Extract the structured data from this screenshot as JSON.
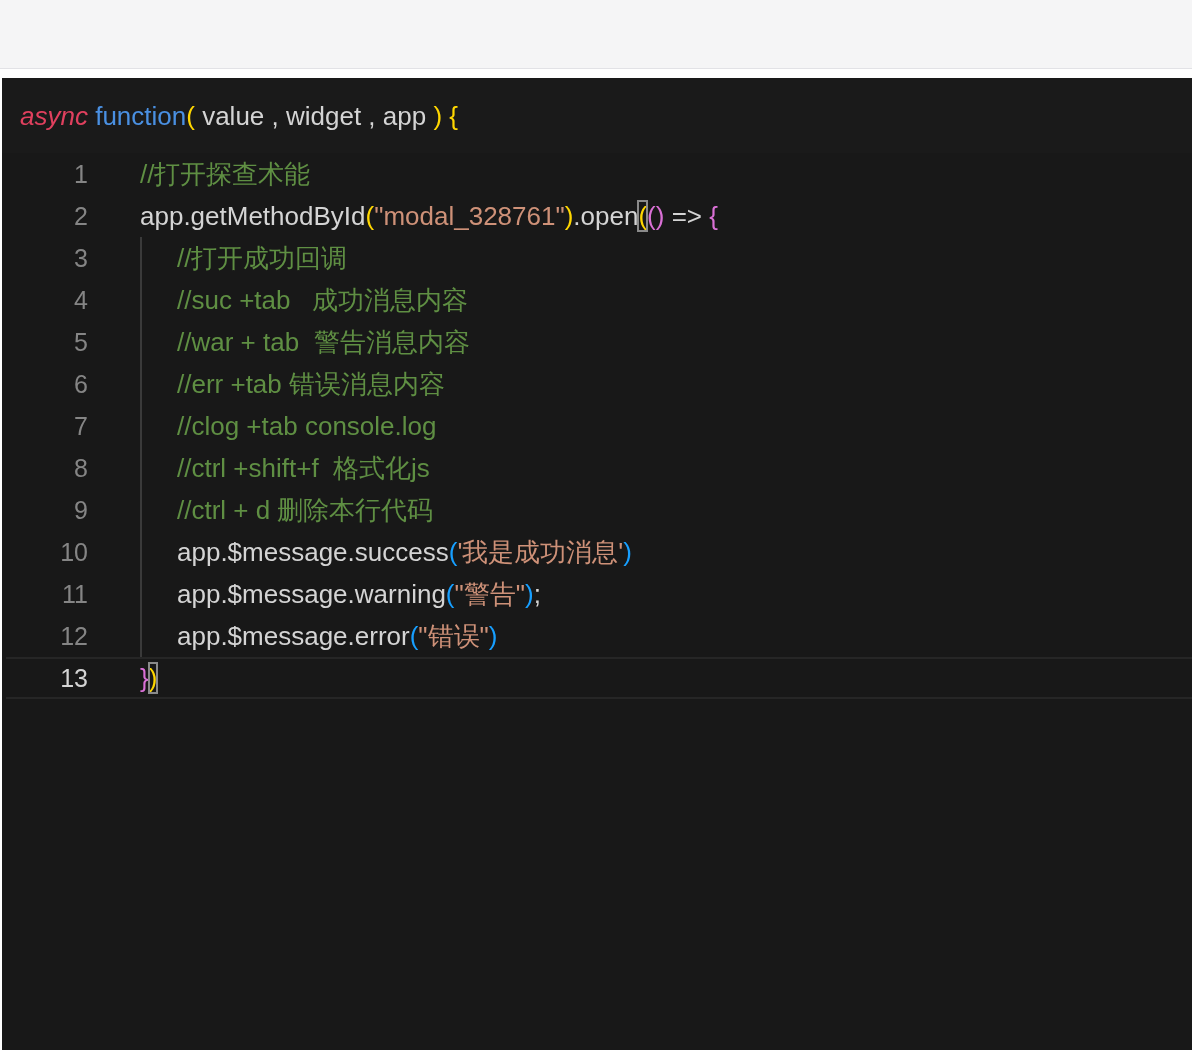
{
  "editor": {
    "signature": [
      {
        "kind": "keyword",
        "text": "async"
      },
      {
        "kind": "function",
        "text": "function"
      },
      {
        "kind": "paren1",
        "text": "("
      },
      {
        "kind": "plain",
        "text": " value , widget , app "
      },
      {
        "kind": "paren1",
        "text": ") {"
      }
    ],
    "lines": [
      {
        "number": "1",
        "current": false,
        "tokens": [
          {
            "kind": "comment",
            "text": "//打开探查术能"
          }
        ]
      },
      {
        "number": "2",
        "current": false,
        "tokens": [
          {
            "kind": "plain",
            "text": "app.getMethodById"
          },
          {
            "kind": "paren1",
            "text": "("
          },
          {
            "kind": "string",
            "text": "\"modal_328761\""
          },
          {
            "kind": "paren1",
            "text": ")"
          },
          {
            "kind": "plain",
            "text": ".open"
          },
          {
            "kind": "matched_bracket",
            "text": "("
          },
          {
            "kind": "paren2",
            "text": "()"
          },
          {
            "kind": "plain",
            "text": " => "
          },
          {
            "kind": "paren2",
            "text": "{"
          }
        ],
        "children": [
          {
            "number": "3",
            "current": false,
            "tokens": [
              {
                "kind": "comment",
                "text": "//打开成功回调"
              }
            ]
          },
          {
            "number": "4",
            "current": false,
            "tokens": [
              {
                "kind": "comment",
                "text": "//suc +tab   成功消息内容"
              }
            ]
          },
          {
            "number": "5",
            "current": false,
            "tokens": [
              {
                "kind": "comment",
                "text": "//war + tab  警告消息内容"
              }
            ]
          },
          {
            "number": "6",
            "current": false,
            "tokens": [
              {
                "kind": "comment",
                "text": "//err +tab 错误消息内容"
              }
            ]
          },
          {
            "number": "7",
            "current": false,
            "tokens": [
              {
                "kind": "comment",
                "text": "//clog +tab console.log"
              }
            ]
          },
          {
            "number": "8",
            "current": false,
            "tokens": [
              {
                "kind": "comment",
                "text": "//ctrl +shift+f  格式化js"
              }
            ]
          },
          {
            "number": "9",
            "current": false,
            "tokens": [
              {
                "kind": "comment",
                "text": "//ctrl + d 删除本行代码"
              }
            ]
          },
          {
            "number": "10",
            "current": false,
            "tokens": [
              {
                "kind": "plain",
                "text": "app.$message.success"
              },
              {
                "kind": "paren3",
                "text": "("
              },
              {
                "kind": "string",
                "text": "'我是成功消息'"
              },
              {
                "kind": "paren3",
                "text": ")"
              }
            ]
          },
          {
            "number": "11",
            "current": false,
            "tokens": [
              {
                "kind": "plain",
                "text": "app.$message.warning"
              },
              {
                "kind": "paren3",
                "text": "("
              },
              {
                "kind": "string",
                "text": "\"警告\""
              },
              {
                "kind": "paren3",
                "text": ")"
              },
              {
                "kind": "plain",
                "text": ";"
              }
            ]
          },
          {
            "number": "12",
            "current": false,
            "tokens": [
              {
                "kind": "plain",
                "text": "app.$message.error"
              },
              {
                "kind": "paren3",
                "text": "("
              },
              {
                "kind": "string",
                "text": "\"错误\""
              },
              {
                "kind": "paren3",
                "text": ")"
              }
            ]
          }
        ]
      },
      {
        "number": "13",
        "current": true,
        "tokens": [
          {
            "kind": "paren2",
            "text": "}"
          },
          {
            "kind": "matched_bracket",
            "text": ")"
          }
        ]
      }
    ]
  }
}
